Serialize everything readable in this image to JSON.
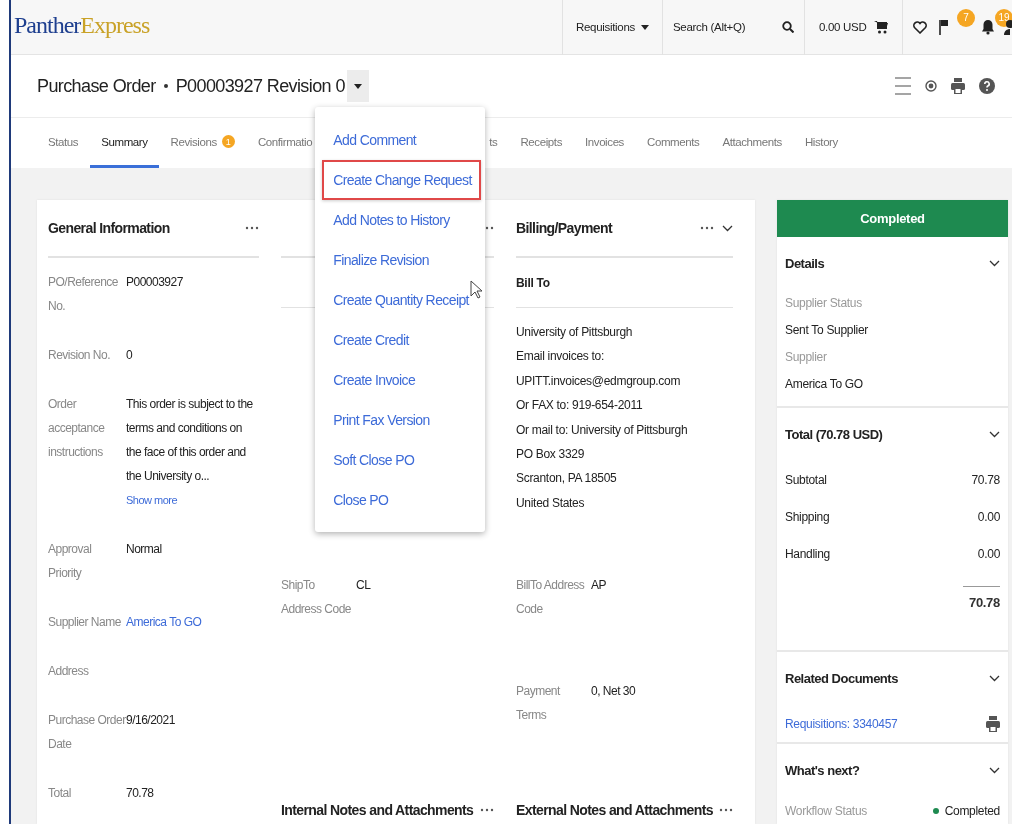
{
  "logo": {
    "text": "Panther",
    "accent": "Express"
  },
  "topbar": {
    "items": [
      {
        "kind": "dropdown",
        "label": "Requisitions"
      },
      {
        "kind": "search",
        "label": "Search (Alt+Q)"
      },
      {
        "kind": "cart",
        "label": "0.00 USD"
      },
      {
        "kind": "favorites"
      },
      {
        "kind": "flag",
        "badge": "7"
      },
      {
        "kind": "bell",
        "badge": "19"
      },
      {
        "kind": "user"
      }
    ]
  },
  "header": {
    "title": "Purchase Order",
    "number": "P00003927 Revision 0"
  },
  "tabs": [
    {
      "label": "Status",
      "selected": false
    },
    {
      "label": "Summary",
      "selected": true
    },
    {
      "label": "Revisions",
      "selected": false,
      "badge": "1"
    },
    {
      "label": "Confirmatio",
      "selected": false,
      "kind": "cut_end"
    },
    {
      "label": "ts",
      "selected": false,
      "kind": "cut_start"
    },
    {
      "label": "Receipts",
      "selected": false
    },
    {
      "label": "Invoices",
      "selected": false
    },
    {
      "label": "Comments",
      "selected": false
    },
    {
      "label": "Attachments",
      "selected": false
    },
    {
      "label": "History",
      "selected": false
    }
  ],
  "actions_menu": {
    "items": [
      {
        "label": "Add Comment",
        "selected": false
      },
      {
        "label": "Create Change Request",
        "selected": true
      },
      {
        "label": "Add Notes to History",
        "selected": false
      },
      {
        "label": "Finalize Revision",
        "selected": false
      },
      {
        "label": "Create Quantity Receipt",
        "selected": false
      },
      {
        "label": "Create Credit",
        "selected": false
      },
      {
        "label": "Create Invoice",
        "selected": false
      },
      {
        "label": "Print Fax Version",
        "selected": false
      },
      {
        "label": "Soft Close PO",
        "selected": false
      },
      {
        "label": "Close PO",
        "selected": false
      }
    ]
  },
  "general_information": {
    "title": "General Information",
    "fields": [
      {
        "label": "PO/Reference No.",
        "value": "P00003927"
      },
      {
        "label": "Revision No.",
        "value": "0"
      },
      {
        "label": "Order acceptance instructions",
        "value": "This order is subject to the terms and conditions on the face of this order and the University o...",
        "more": "Show more"
      },
      {
        "label": "Approval Priority",
        "value": "Normal"
      },
      {
        "label": "Supplier Name",
        "value": "America To GO",
        "link": true
      },
      {
        "label": "Address"
      },
      {
        "label": "Purchase Order Date",
        "value": "9/16/2021"
      },
      {
        "label": "Total",
        "value": "70.78"
      }
    ]
  },
  "shipping": {
    "fields": [
      {
        "label": "ShipTo Address Code",
        "value": "CL"
      }
    ],
    "notes_title": "Internal Notes and Attachments"
  },
  "billing": {
    "title": "Billing/Payment",
    "subtitle": "Bill To",
    "address": [
      "University of Pittsburgh",
      "Email invoices to:",
      "UPITT.invoices@edmgroup.com",
      "Or FAX to: 919-654-2011",
      "Or mail to: University of Pittsburgh",
      "PO Box 3329",
      "Scranton, PA 18505",
      "United States"
    ],
    "fields": [
      {
        "label": "BillTo Address Code",
        "value": "AP"
      },
      {
        "label": "Payment Terms",
        "value": "0, Net 30"
      }
    ],
    "notes_title": "External Notes and Attachments"
  },
  "side_panel": {
    "status": "Completed",
    "details": {
      "title": "Details",
      "fields": [
        {
          "label": "Supplier Status",
          "value": "Sent To Supplier"
        },
        {
          "label": "Supplier",
          "value": "America To GO"
        }
      ]
    },
    "total": {
      "title": "Total (70.78 USD)",
      "rows": [
        {
          "label": "Subtotal",
          "value": "70.78"
        },
        {
          "label": "Shipping",
          "value": "0.00"
        },
        {
          "label": "Handling",
          "value": "0.00"
        }
      ],
      "sum": "70.78"
    },
    "related": {
      "title": "Related Documents",
      "link": "Requisitions: 3340457"
    },
    "next": {
      "title": "What's next?",
      "label": "Workflow Status",
      "value": "Completed"
    }
  }
}
